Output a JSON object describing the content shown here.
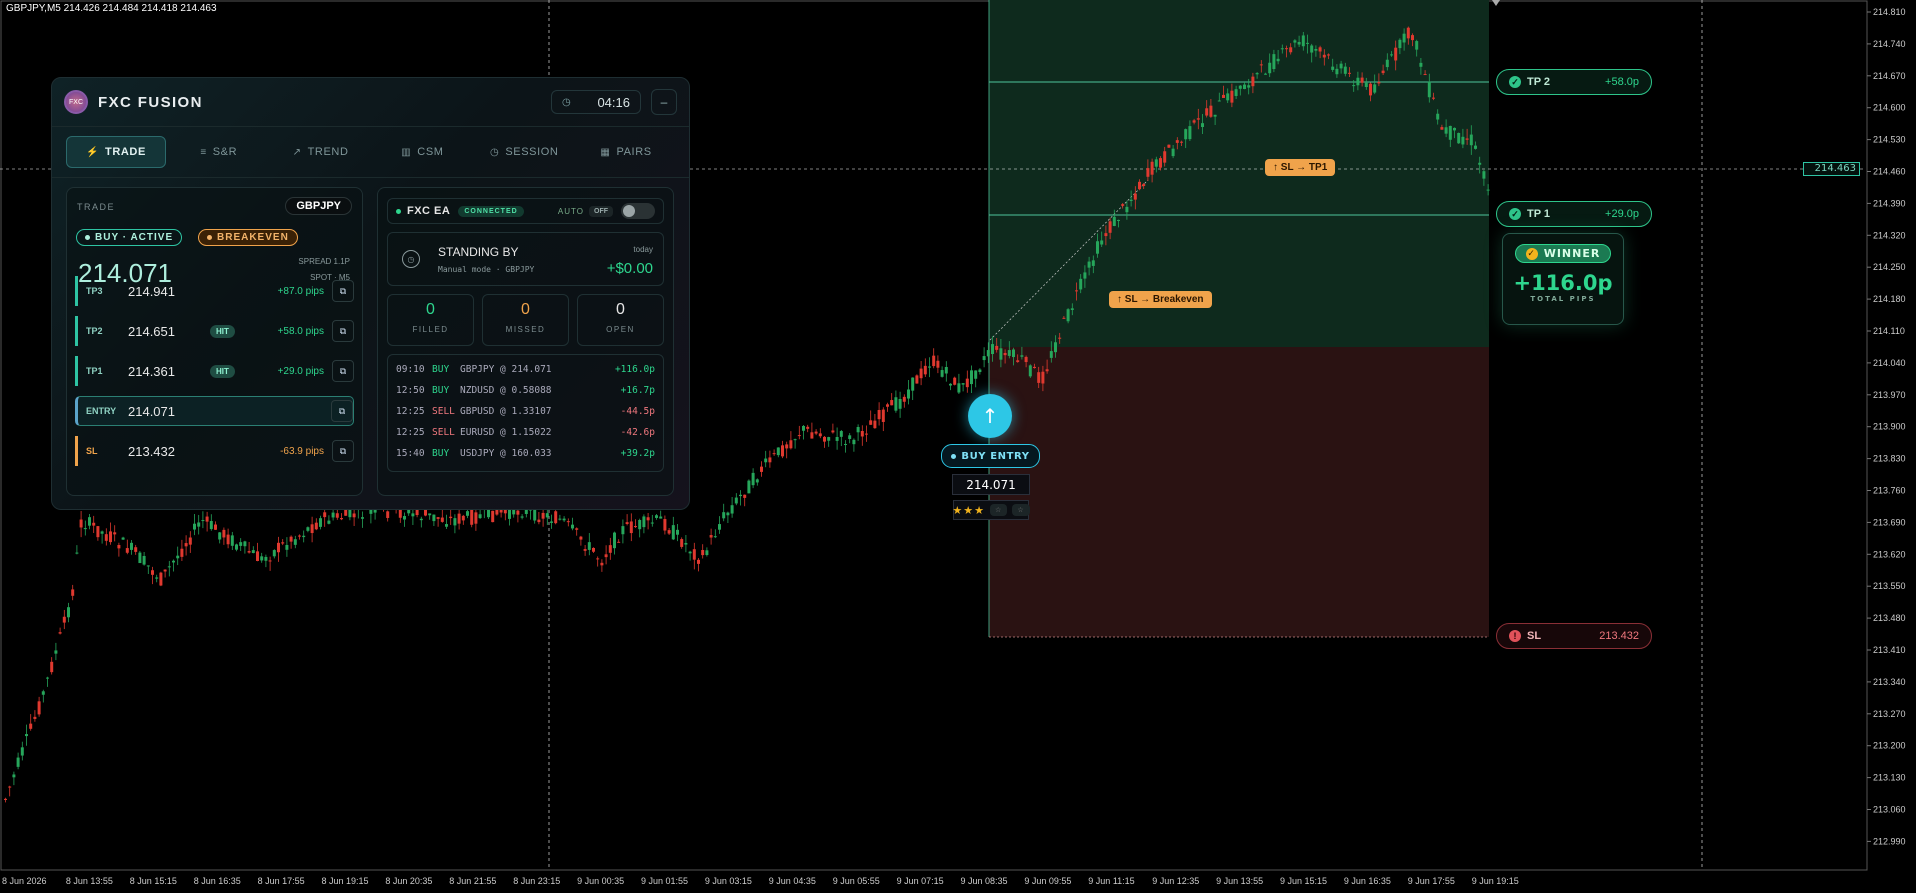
{
  "ohlc_header": "GBPJPY,M5  214.426 214.484 214.418 214.463",
  "current_price": "214.463",
  "price_axis": [
    "214.810",
    "214.740",
    "214.670",
    "214.600",
    "214.530",
    "214.460",
    "214.390",
    "214.320",
    "214.250",
    "214.180",
    "214.110",
    "214.040",
    "213.970",
    "213.900",
    "213.830",
    "213.760",
    "213.690",
    "213.620",
    "213.550",
    "213.480",
    "213.410",
    "213.340",
    "213.270",
    "213.200",
    "213.130",
    "213.060",
    "212.990"
  ],
  "time_axis": [
    "8 Jun 2026",
    "8 Jun 13:55",
    "8 Jun 15:15",
    "8 Jun 16:35",
    "8 Jun 17:55",
    "8 Jun 19:15",
    "8 Jun 20:35",
    "8 Jun 21:55",
    "8 Jun 23:15",
    "9 Jun 00:35",
    "9 Jun 01:55",
    "9 Jun 03:15",
    "9 Jun 04:35",
    "9 Jun 05:55",
    "9 Jun 07:15",
    "9 Jun 08:35",
    "9 Jun 09:55",
    "9 Jun 11:15",
    "9 Jun 12:35",
    "9 Jun 13:55",
    "9 Jun 15:15",
    "9 Jun 16:35",
    "9 Jun 17:55",
    "9 Jun 19:15"
  ],
  "chart_markers": {
    "tp2": {
      "label": "TP 2",
      "value": "+58.0p"
    },
    "tp1": {
      "label": "TP 1",
      "value": "+29.0p"
    },
    "sl": {
      "label": "SL",
      "value": "213.432"
    },
    "tag_sl_tp1": "↑ SL → TP1",
    "tag_sl_be": "↑ SL → Breakeven",
    "winner_label": "WINNER",
    "winner_pips": "+116.0p",
    "winner_sub": "TOTAL PIPS",
    "entry_label": "BUY ENTRY",
    "entry_price": "214.071",
    "entry_rating": 3,
    "entry_rating_max": 5
  },
  "panel": {
    "brand": "FXC FUSION",
    "logo_text": "FXC",
    "clock": "04:16",
    "minimize": "–",
    "tabs": [
      {
        "icon": "⚡",
        "label": "TRADE"
      },
      {
        "icon": "≡",
        "label": "S&R"
      },
      {
        "icon": "↗",
        "label": "TREND"
      },
      {
        "icon": "▥",
        "label": "CSM"
      },
      {
        "icon": "◷",
        "label": "SESSION"
      },
      {
        "icon": "▦",
        "label": "PAIRS"
      }
    ],
    "trade": {
      "title": "TRADE",
      "pair": "GBPJPY",
      "status": "BUY · ACTIVE",
      "mode": "BREAKEVEN",
      "price": "214.071",
      "spread": "SPREAD 1.1P",
      "spot": "SPOT · M5",
      "rows": [
        {
          "key": "TP3",
          "price": "214.941",
          "hit": "",
          "pips": "+87.0 pips"
        },
        {
          "key": "TP2",
          "price": "214.651",
          "hit": "HIT",
          "pips": "+58.0 pips"
        },
        {
          "key": "TP1",
          "price": "214.361",
          "hit": "HIT",
          "pips": "+29.0 pips"
        },
        {
          "key": "ENTRY",
          "price": "214.071",
          "hit": "",
          "pips": ""
        },
        {
          "key": "SL",
          "price": "213.432",
          "hit": "",
          "pips": "-63.9 pips"
        }
      ]
    },
    "ea": {
      "name": "FXC EA",
      "connected": "CONNECTED",
      "auto_label": "AUTO",
      "auto_state": "OFF",
      "standby_title": "STANDING BY",
      "standby_sub": "Manual mode · GBPJPY",
      "today_label": "today",
      "today_value": "+$0.00",
      "stats": [
        {
          "value": "0",
          "label": "FILLED",
          "color": "#2ed68e"
        },
        {
          "value": "0",
          "label": "MISSED",
          "color": "#f0a34b"
        },
        {
          "value": "0",
          "label": "OPEN",
          "color": "#e6e6e6"
        }
      ],
      "log": [
        {
          "time": "09:10",
          "side": "BUY",
          "sym": "GBPJPY @ 214.071",
          "pips": "+116.0p"
        },
        {
          "time": "12:50",
          "side": "BUY",
          "sym": "NZDUSD @ 0.58088",
          "pips": "+16.7p"
        },
        {
          "time": "12:25",
          "side": "SELL",
          "sym": "GBPUSD @ 1.33107",
          "pips": "-44.5p"
        },
        {
          "time": "12:25",
          "side": "SELL",
          "sym": "EURUSD @ 1.15022",
          "pips": "-42.6p"
        },
        {
          "time": "15:40",
          "side": "BUY",
          "sym": "USDJPY @ 160.033",
          "pips": "+39.2p"
        }
      ]
    }
  },
  "colors": {
    "bull": "#26a65b",
    "bear": "#e0392f",
    "profit_zone": "#0e2a1d",
    "loss_zone": "#2a1212",
    "tp_line": "#4fc49a"
  }
}
